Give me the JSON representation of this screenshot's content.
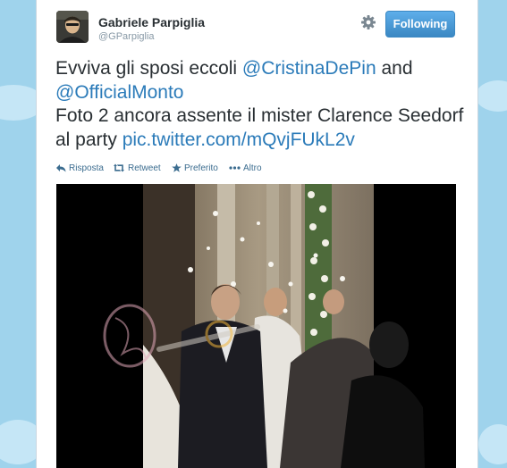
{
  "tweet": {
    "author_name": "Gabriele Parpiglia",
    "author_handle": "@GParpiglia",
    "follow_label": "Following",
    "text_part1": "Evviva gli sposi eccoli ",
    "mention1": "@CristinaDePin",
    "text_part2": " and ",
    "mention2": "@OfficialMonto",
    "text_part3": "Foto 2 ancora assente il mister Clarence Seedorf al party ",
    "pic_link": "pic.twitter.com/mQvjFUkL2v"
  },
  "actions": {
    "reply_label": "Risposta",
    "retweet_label": "Retweet",
    "favorite_label": "Preferito",
    "more_label": "Altro"
  },
  "icons": {
    "settings": "gear-icon",
    "reply": "reply-icon",
    "retweet": "retweet-icon",
    "favorite": "star-icon",
    "more": "ellipsis-icon"
  },
  "colors": {
    "link": "#2b7bb9",
    "follow_button": "#3b88c3",
    "background": "#9fd3ec"
  }
}
